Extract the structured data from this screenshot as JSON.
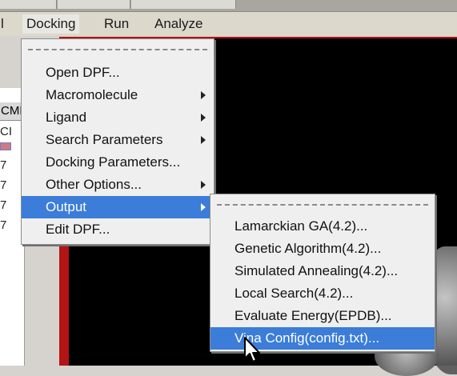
{
  "menubar": {
    "items": [
      {
        "label": "l"
      },
      {
        "label": "Docking"
      },
      {
        "label": "Run"
      },
      {
        "label": "Analyze"
      }
    ]
  },
  "left_panel": {
    "header": "CMD",
    "cell_top": "CI",
    "rows": [
      "7",
      "7",
      "7",
      "7"
    ]
  },
  "docking_menu": {
    "items": [
      {
        "label": "Open DPF...",
        "submenu": false
      },
      {
        "label": "Macromolecule",
        "submenu": true
      },
      {
        "label": "Ligand",
        "submenu": true
      },
      {
        "label": "Search Parameters",
        "submenu": true
      },
      {
        "label": "Docking Parameters...",
        "submenu": false
      },
      {
        "label": "Other Options...",
        "submenu": true
      },
      {
        "label": "Output",
        "submenu": true,
        "highlighted": true
      },
      {
        "label": "Edit DPF...",
        "submenu": false
      }
    ]
  },
  "output_submenu": {
    "items": [
      {
        "label": "Lamarckian GA(4.2)..."
      },
      {
        "label": "Genetic Algorithm(4.2)..."
      },
      {
        "label": "Simulated Annealing(4.2)..."
      },
      {
        "label": "Local Search(4.2)..."
      },
      {
        "label": "Evaluate Energy(EPDB)..."
      },
      {
        "label": "Vina Config(config.txt)...",
        "highlighted": true
      }
    ]
  },
  "colors": {
    "highlight": "#3b7dd8",
    "viewport": "#000000",
    "frame": "#b41414"
  }
}
